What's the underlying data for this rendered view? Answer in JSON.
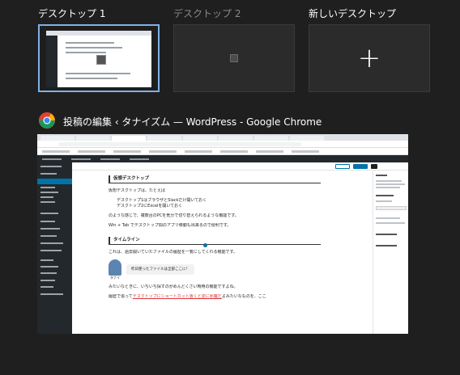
{
  "desktops": [
    {
      "label": "デスクトップ 1",
      "active": true
    },
    {
      "label": "デスクトップ 2",
      "active": false
    }
  ],
  "new_desktop_label": "新しいデスクトップ",
  "window": {
    "title": "投稿の編集 ‹ タナイズム — WordPress - Google Chrome",
    "app_icon": "chrome-icon"
  },
  "page": {
    "heading1": "仮想デスクトップ",
    "p1": "仮想デスクトップは、たとえば",
    "list": [
      "デスクトップ1はブラウザとSlackだけ開いておく",
      "デスクトップ2にExcelを開いておく"
    ],
    "p2": "のような感じで、複数台のPCを気分で切り替えられるような機能です。",
    "p3": "Win + Tab でデスクトップ間のアプリ移動も出来るので便利です。",
    "heading2": "タイムライン",
    "p4": "これは、過去開いていたファイルの履歴を一覧にしてくれる機能です。",
    "bubble": "昨日使ったファイルは全部ここに！",
    "avatar_label": "タナイ",
    "p5": "みたいなときに、いちいち探すのがめんどくさい時用の機能ですよね。",
    "p6_a": "履歴で追って",
    "p6_link": "デスクトップにショートカット置くと逆に邪魔だ",
    "p6_b": "よみたいなものを、ここ"
  },
  "colors": {
    "background": "#1f1f1f",
    "active_border": "#7fb2e6",
    "wp_admin": "#23282d",
    "wp_accent": "#0073aa"
  }
}
